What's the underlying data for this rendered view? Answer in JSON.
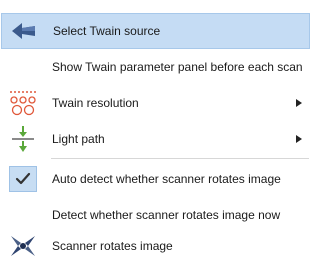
{
  "menu": {
    "items": [
      {
        "label": "Select Twain source",
        "icon": "twain-source-arrow-icon"
      },
      {
        "label": "Show Twain parameter panel before each scan",
        "icon": ""
      },
      {
        "label": "Twain resolution",
        "icon": "resolution-dots-icon",
        "submenu": true
      },
      {
        "label": "Light path",
        "icon": "light-path-icon",
        "submenu": true
      },
      {
        "label": "Auto detect whether scanner rotates image",
        "icon": "checkmark-icon",
        "checked": true
      },
      {
        "label": "Detect whether scanner rotates image now",
        "icon": ""
      },
      {
        "label": "Scanner rotates image",
        "icon": "scanner-rotates-icon"
      }
    ]
  },
  "colors": {
    "highlight_bg": "#c5dcf4",
    "icon_blue": "#3b5a8c",
    "icon_red": "#e0583a",
    "icon_green": "#5aa83a",
    "separator": "#d7d7d7"
  }
}
